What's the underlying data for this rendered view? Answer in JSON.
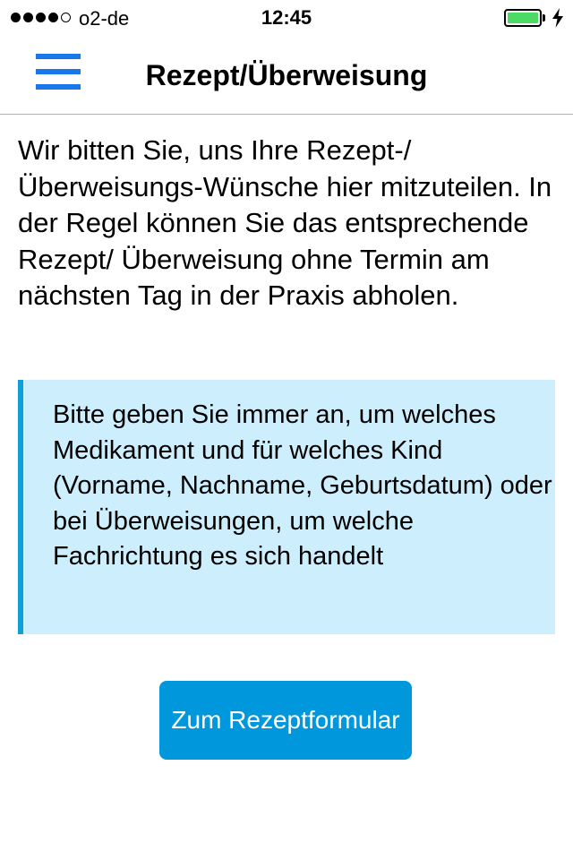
{
  "status_bar": {
    "signal_bars_filled": 4,
    "signal_bars_total": 5,
    "carrier": "o2-de",
    "time": "12:45",
    "battery_level_percent": 100,
    "charging": true,
    "icons": [
      "signal-dots-icon",
      "battery-icon",
      "charging-bolt-icon"
    ]
  },
  "nav": {
    "menu_icon": "hamburger-menu-icon",
    "title": "Rezept/Überweisung"
  },
  "content": {
    "intro_text": "Wir bitten Sie, uns Ihre Rezept-/ Überweisungs-Wünsche hier mitzuteilen. In der Regel können Sie das entsprechende Rezept/ Überweisung ohne Termin am nächsten Tag in der Praxis abholen.",
    "notice_text": "Bitte geben Sie immer an, um welches Medikament und für welches Kind (Vorname, Nachname, Geburtsdatum) oder bei Überweisungen, um welche Fachrichtung es sich handelt",
    "button_label": "Zum Rezeptformular"
  },
  "colors": {
    "accent": "#1878ea",
    "battery": "#4cd964",
    "notice_background": "#cdeefc",
    "notice_border": "#0fa0dc",
    "button_background": "#0097dd",
    "button_text": "#ffffff"
  }
}
